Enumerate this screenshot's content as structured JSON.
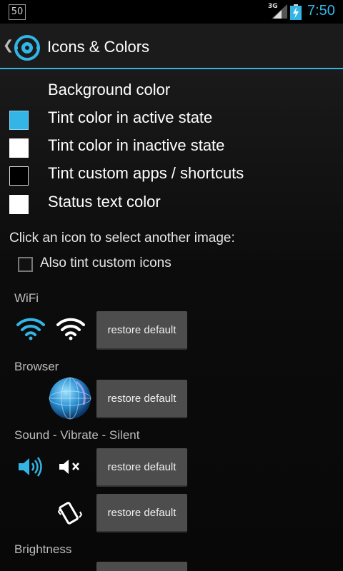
{
  "status_bar": {
    "notification_count": "50",
    "network": "3G",
    "time": "7:50"
  },
  "action_bar": {
    "title": "Icons & Colors"
  },
  "colors": {
    "accent": "#33b5e5",
    "white": "#ffffff"
  },
  "prefs": [
    {
      "label": "Background color",
      "swatch": "none"
    },
    {
      "label": "Tint color in active state",
      "swatch": "#33b5e5"
    },
    {
      "label": "Tint color in inactive state",
      "swatch": "#ffffff"
    },
    {
      "label": "Tint custom apps / shortcuts",
      "swatch": "outline"
    },
    {
      "label": "Status text color",
      "swatch": "#ffffff"
    }
  ],
  "hint": "Click an icon to select another image:",
  "tint_custom_icons": {
    "label": "Also tint custom icons",
    "checked": false
  },
  "sections": [
    {
      "title": "WiFi",
      "icons": [
        "wifi-active-icon",
        "wifi-inactive-icon"
      ],
      "button": "restore default"
    },
    {
      "title": "Browser",
      "icons": [
        "globe-icon"
      ],
      "button": "restore default"
    },
    {
      "title": "Sound - Vibrate - Silent",
      "icons": [
        "sound-on-icon",
        "mute-icon"
      ],
      "button": "restore default",
      "extra_button": "restore default",
      "extra_icons": [
        "vibrate-icon"
      ]
    },
    {
      "title": "Brightness"
    }
  ]
}
